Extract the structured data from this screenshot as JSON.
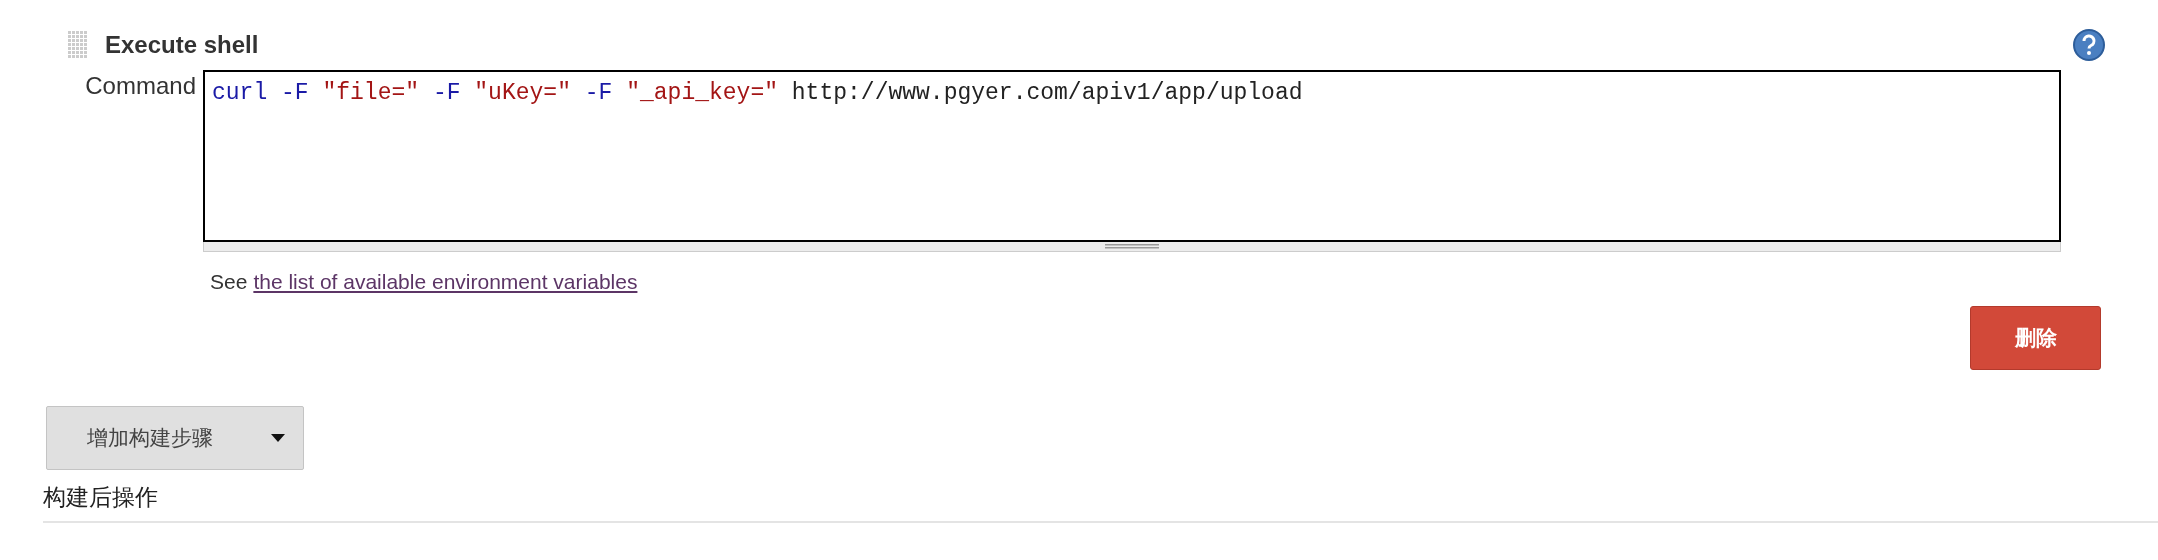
{
  "step": {
    "title": "Execute shell"
  },
  "command": {
    "label": "Command",
    "tokens": [
      {
        "kind": "keyword",
        "text": "curl"
      },
      {
        "kind": "flag",
        "text": "-F"
      },
      {
        "kind": "string",
        "text": "\"file=\""
      },
      {
        "kind": "flag",
        "text": "-F"
      },
      {
        "kind": "string",
        "text": "\"uKey=\""
      },
      {
        "kind": "flag",
        "text": "-F"
      },
      {
        "kind": "string",
        "text": "\"_api_key=\""
      },
      {
        "kind": "plain",
        "text": "http://www.pgyer.com/apiv1/app/upload"
      }
    ]
  },
  "hint": {
    "prefix": "See",
    "link": "the list of available environment variables"
  },
  "delete_button": "删除",
  "add_step_button": "增加构建步骤",
  "section_title": "构建后操作"
}
